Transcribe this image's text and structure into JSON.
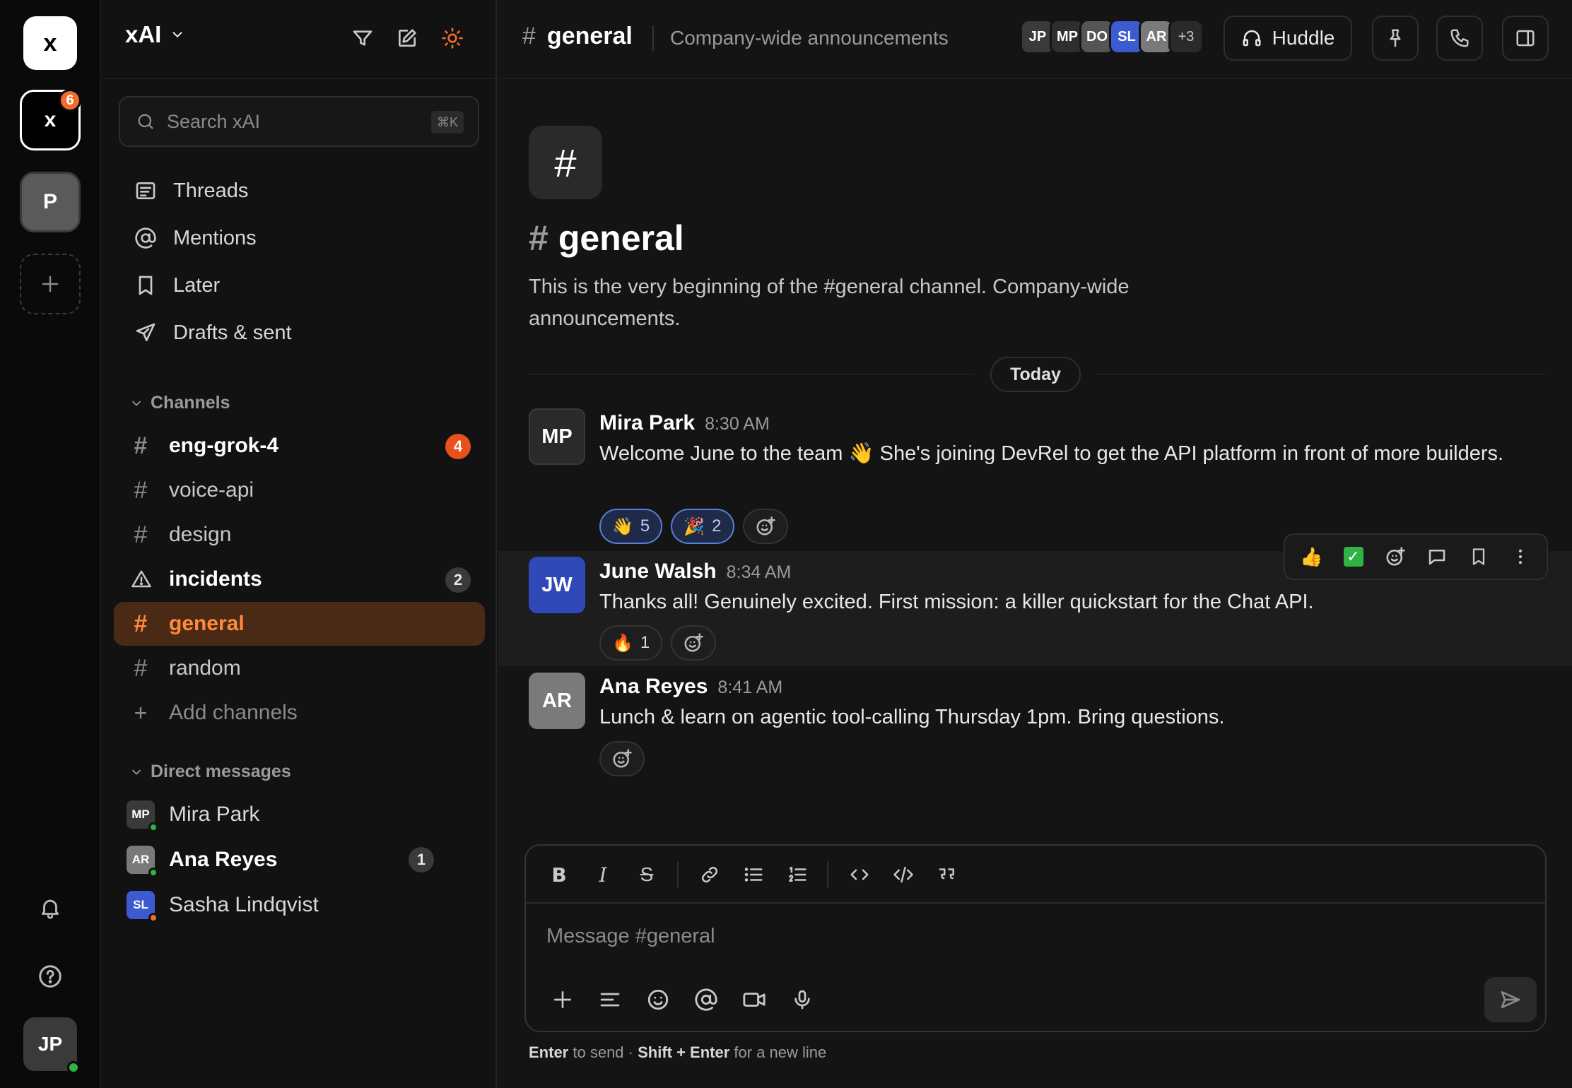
{
  "rail": {
    "workspaces": [
      {
        "label": "x"
      },
      {
        "label": "x",
        "badge": "6"
      },
      {
        "label": "P"
      }
    ],
    "user_initials": "JP",
    "icons": [
      "plus-icon",
      "bell-icon",
      "help-icon"
    ]
  },
  "sidebar": {
    "workspace_name": "xAI",
    "search_placeholder": "Search  xAI",
    "search_shortcut": "⌘K",
    "nav": [
      {
        "label": "Threads",
        "icon": "threads-icon"
      },
      {
        "label": "Mentions",
        "icon": "at-icon"
      },
      {
        "label": "Later",
        "icon": "bookmark-icon"
      },
      {
        "label": "Drafts & sent",
        "icon": "send-icon"
      }
    ],
    "channels_label": "Channels",
    "channels": [
      {
        "name": "eng-grok-4",
        "badge": "4",
        "unread": true
      },
      {
        "name": "voice-api"
      },
      {
        "name": "design"
      },
      {
        "name": "incidents",
        "badge": "2",
        "unread": true,
        "icon": "warning-icon"
      },
      {
        "name": "general",
        "active": true
      },
      {
        "name": "random"
      }
    ],
    "add_channels": "Add channels",
    "dms_label": "Direct messages",
    "dms": [
      {
        "name": "Mira Park",
        "initials": "MP",
        "status": "online"
      },
      {
        "name": "Ana Reyes",
        "initials": "AR",
        "status": "online",
        "badge": "1",
        "unread": true
      },
      {
        "name": "Sasha Lindqvist",
        "initials": "SL",
        "status": "away"
      }
    ]
  },
  "channel": {
    "name": "general",
    "description": "Company-wide announcements",
    "members": [
      "JP",
      "MP",
      "DO",
      "SL",
      "AR"
    ],
    "members_more": "+3",
    "huddle_label": "Huddle",
    "intro_title": "general",
    "intro_text": "This is the very beginning of the #general channel. Company-wide announcements."
  },
  "day_divider": "Today",
  "messages": [
    {
      "author": "Mira Park",
      "initials": "MP",
      "time": "8:30 AM",
      "text": "Welcome June to the team 👋 She's joining DevRel to get the API platform in front of more builders.",
      "reactions": [
        {
          "emoji": "👋",
          "count": "5",
          "mine": true
        },
        {
          "emoji": "🎉",
          "count": "2",
          "mine": true
        }
      ]
    },
    {
      "author": "June Walsh",
      "initials": "JW",
      "time": "8:34 AM",
      "text": "Thanks all! Genuinely excited. First mission: a killer quickstart for the Chat API.",
      "reactions": [
        {
          "emoji": "🔥",
          "count": "1",
          "mine": false
        }
      ]
    },
    {
      "author": "Ana Reyes",
      "initials": "AR",
      "time": "8:41 AM",
      "text": "Lunch & learn on agentic tool-calling Thursday 1pm. Bring questions.",
      "reactions": []
    }
  ],
  "message_toolbar": {
    "thumbs": "👍",
    "check": "✓"
  },
  "composer": {
    "placeholder": "Message #general",
    "hint_send_key": "Enter",
    "hint_send_text": "to send ·",
    "hint_newline_key": "Shift + Enter",
    "hint_newline_text": "for a new line"
  },
  "colors": {
    "accent": "#f26b2a",
    "active_bg": "#4a2a15",
    "online": "#2fb344",
    "away": "#f26b2a",
    "reaction_mine": "#5a7ed8"
  }
}
